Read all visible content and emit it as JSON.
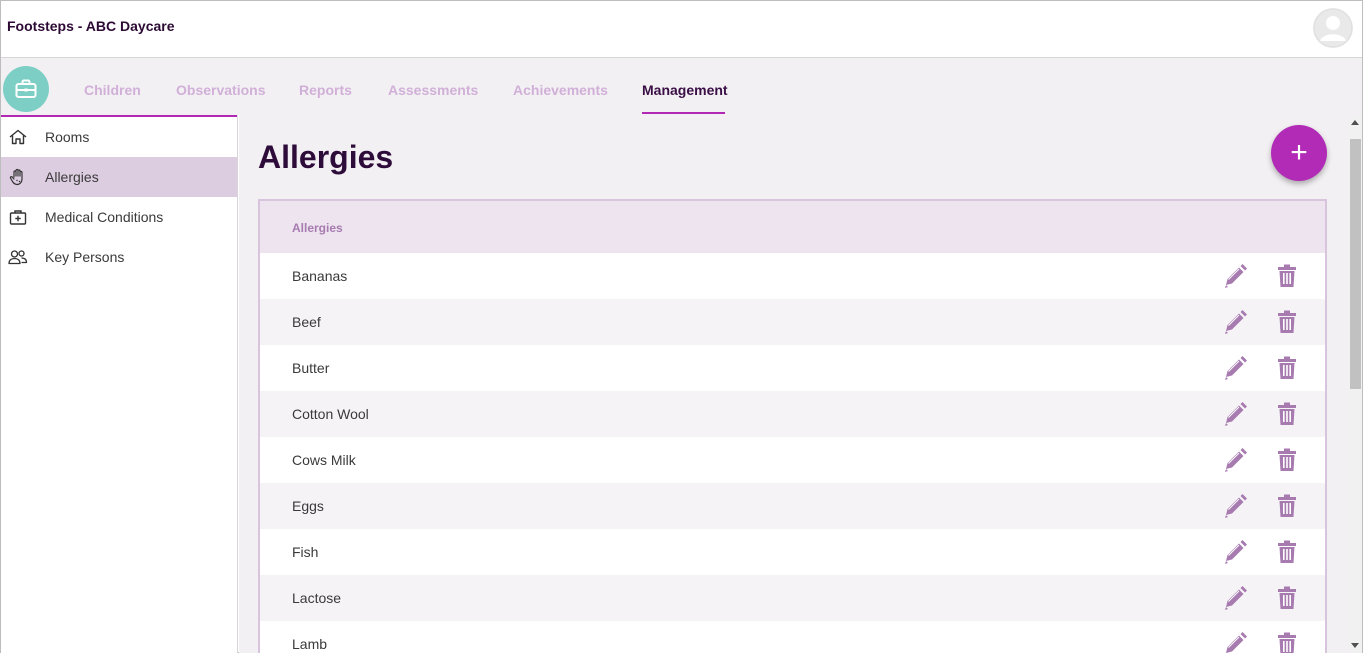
{
  "app": {
    "title": "Footsteps - ABC Daycare"
  },
  "nav": {
    "tabs": [
      {
        "label": "Children"
      },
      {
        "label": "Observations"
      },
      {
        "label": "Reports"
      },
      {
        "label": "Assessments"
      },
      {
        "label": "Achievements"
      },
      {
        "label": "Management",
        "active": true
      }
    ]
  },
  "sidebar": {
    "items": [
      {
        "label": "Rooms",
        "icon": "home-icon"
      },
      {
        "label": "Allergies",
        "icon": "hand-icon",
        "selected": true
      },
      {
        "label": "Medical Conditions",
        "icon": "medical-kit-icon"
      },
      {
        "label": "Key Persons",
        "icon": "people-icon"
      }
    ]
  },
  "main": {
    "title": "Allergies",
    "add_button": "+",
    "table": {
      "header": "Allergies",
      "rows": [
        "Bananas",
        "Beef",
        "Butter",
        "Cotton Wool",
        "Cows Milk",
        "Eggs",
        "Fish",
        "Lactose",
        "Lamb"
      ]
    }
  },
  "colors": {
    "accent": "#b12bb6",
    "header_text": "#2e0c3a",
    "icon_muted": "#a77bb0",
    "logo_bg": "#7dcfc6",
    "selected_bg": "#dccde1"
  }
}
